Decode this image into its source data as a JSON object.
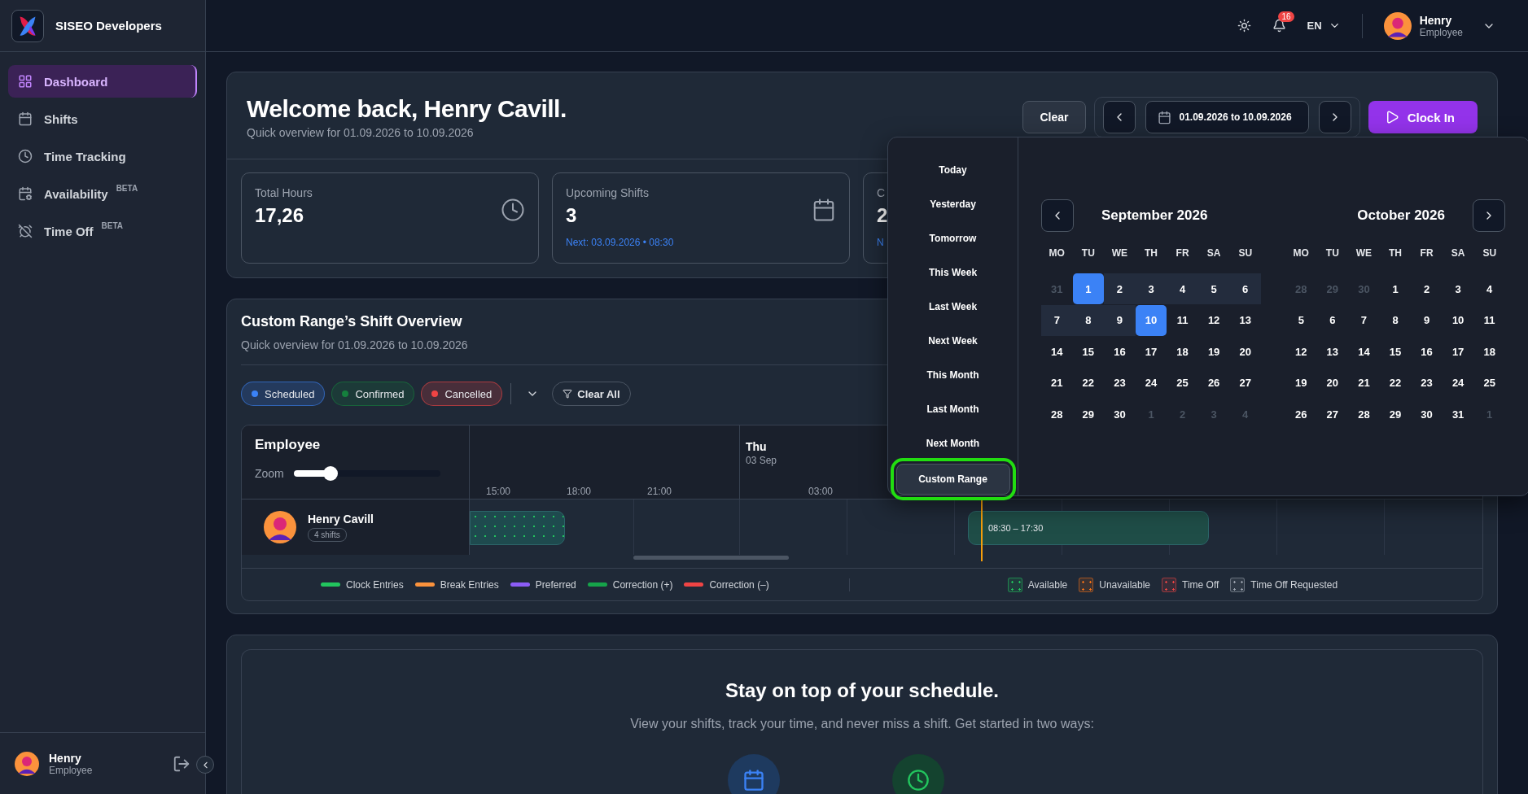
{
  "sidebar": {
    "brand": "SISEO Developers",
    "items": [
      {
        "label": "Dashboard",
        "selected": true
      },
      {
        "label": "Shifts",
        "selected": false
      },
      {
        "label": "Time Tracking",
        "selected": false
      },
      {
        "label": "Availability",
        "badge": "BETA",
        "selected": false
      },
      {
        "label": "Time Off",
        "badge": "BETA",
        "selected": false
      }
    ],
    "user": {
      "name": "Henry",
      "role": "Employee"
    }
  },
  "header": {
    "notifications": "16",
    "language": "EN",
    "user": {
      "name": "Henry",
      "role": "Employee"
    }
  },
  "welcome": {
    "title": "Welcome back, Henry Cavill.",
    "subtitle": "Quick overview for 01.09.2026 to 10.09.2026",
    "clear": "Clear",
    "range": "01.09.2026 to 10.09.2026",
    "clock_in": "Clock In",
    "stats": [
      {
        "label": "Total Hours",
        "value": "17,26"
      },
      {
        "label": "Upcoming Shifts",
        "value": "3",
        "note": "Next: 03.09.2026 • 08:30"
      },
      {
        "label": "C",
        "value": "2",
        "note": "N"
      }
    ]
  },
  "overview": {
    "title": "Custom Range’s Shift Overview",
    "subtitle": "Quick overview for 01.09.2026 to 10.09.2026",
    "filters": [
      {
        "label": "Scheduled",
        "color": "#3b82f6"
      },
      {
        "label": "Confirmed",
        "color": "#15803d"
      },
      {
        "label": "Cancelled",
        "color": "#ef4444"
      }
    ],
    "clear_all": "Clear All",
    "timeline": {
      "employee_header": "Employee",
      "zoom_label": "Zoom",
      "zoom": {
        "level": 0.25
      },
      "day": {
        "name": "Thu",
        "date": "03 Sep"
      },
      "hours": [
        "15:00",
        "18:00",
        "21:00",
        "03:00"
      ],
      "employee": {
        "name": "Henry Cavill",
        "badge": "4 shifts"
      },
      "shift_label": "08:30 – 17:30"
    },
    "legend": [
      {
        "label": "Clock Entries",
        "kind": "line",
        "color": "#22c55e"
      },
      {
        "label": "Break Entries",
        "kind": "line",
        "color": "#fb923c"
      },
      {
        "label": "Preferred",
        "kind": "line",
        "color": "#8b5cf6"
      },
      {
        "label": "Correction (+)",
        "kind": "line",
        "color": "#16a34a"
      },
      {
        "label": "Correction (–)",
        "kind": "line",
        "color": "#ef4444"
      },
      {
        "label": "Available",
        "kind": "box",
        "color": "#22c55e"
      },
      {
        "label": "Unavailable",
        "kind": "box",
        "color": "#f97316"
      },
      {
        "label": "Time Off",
        "kind": "box",
        "color": "#ef4444"
      },
      {
        "label": "Time Off Requested",
        "kind": "box",
        "color": "#9ca3af"
      }
    ]
  },
  "getting_started": {
    "title": "Stay on top of your schedule.",
    "text": "View your shifts, track your time, and never miss a shift. Get started in two ways:"
  },
  "date_picker": {
    "presets": [
      {
        "label": "Today",
        "selected": false
      },
      {
        "label": "Yesterday",
        "selected": false
      },
      {
        "label": "Tomorrow",
        "selected": false
      },
      {
        "label": "This Week",
        "selected": false
      },
      {
        "label": "Last Week",
        "selected": false
      },
      {
        "label": "Next Week",
        "selected": false
      },
      {
        "label": "This Month",
        "selected": false
      },
      {
        "label": "Last Month",
        "selected": false
      },
      {
        "label": "Next Month",
        "selected": false
      },
      {
        "label": "Custom Range",
        "selected": true
      }
    ],
    "months": [
      {
        "title": "September 2026",
        "weekdays": [
          "MO",
          "TU",
          "WE",
          "TH",
          "FR",
          "SA",
          "SU"
        ],
        "days": [
          {
            "label": "31",
            "outside": true,
            "in_range": false,
            "selected": false
          },
          {
            "label": "1",
            "outside": false,
            "in_range": true,
            "selected": true
          },
          {
            "label": "2",
            "outside": false,
            "in_range": true,
            "selected": false
          },
          {
            "label": "3",
            "outside": false,
            "in_range": true,
            "selected": false
          },
          {
            "label": "4",
            "outside": false,
            "in_range": true,
            "selected": false
          },
          {
            "label": "5",
            "outside": false,
            "in_range": true,
            "selected": false
          },
          {
            "label": "6",
            "outside": false,
            "in_range": true,
            "selected": false
          },
          {
            "label": "7",
            "outside": false,
            "in_range": true,
            "selected": false
          },
          {
            "label": "8",
            "outside": false,
            "in_range": true,
            "selected": false
          },
          {
            "label": "9",
            "outside": false,
            "in_range": true,
            "selected": false
          },
          {
            "label": "10",
            "outside": false,
            "in_range": true,
            "selected": true
          },
          {
            "label": "11",
            "outside": false,
            "in_range": false,
            "selected": false
          },
          {
            "label": "12",
            "outside": false,
            "in_range": false,
            "selected": false
          },
          {
            "label": "13",
            "outside": false,
            "in_range": false,
            "selected": false
          },
          {
            "label": "14",
            "outside": false,
            "in_range": false,
            "selected": false
          },
          {
            "label": "15",
            "outside": false,
            "in_range": false,
            "selected": false
          },
          {
            "label": "16",
            "outside": false,
            "in_range": false,
            "selected": false
          },
          {
            "label": "17",
            "outside": false,
            "in_range": false,
            "selected": false
          },
          {
            "label": "18",
            "outside": false,
            "in_range": false,
            "selected": false
          },
          {
            "label": "19",
            "outside": false,
            "in_range": false,
            "selected": false
          },
          {
            "label": "20",
            "outside": false,
            "in_range": false,
            "selected": false
          },
          {
            "label": "21",
            "outside": false,
            "in_range": false,
            "selected": false
          },
          {
            "label": "22",
            "outside": false,
            "in_range": false,
            "selected": false
          },
          {
            "label": "23",
            "outside": false,
            "in_range": false,
            "selected": false
          },
          {
            "label": "24",
            "outside": false,
            "in_range": false,
            "selected": false
          },
          {
            "label": "25",
            "outside": false,
            "in_range": false,
            "selected": false
          },
          {
            "label": "26",
            "outside": false,
            "in_range": false,
            "selected": false
          },
          {
            "label": "27",
            "outside": false,
            "in_range": false,
            "selected": false
          },
          {
            "label": "28",
            "outside": false,
            "in_range": false,
            "selected": false
          },
          {
            "label": "29",
            "outside": false,
            "in_range": false,
            "selected": false
          },
          {
            "label": "30",
            "outside": false,
            "in_range": false,
            "selected": false
          },
          {
            "label": "1",
            "outside": true,
            "in_range": false,
            "selected": false
          },
          {
            "label": "2",
            "outside": true,
            "in_range": false,
            "selected": false
          },
          {
            "label": "3",
            "outside": true,
            "in_range": false,
            "selected": false
          },
          {
            "label": "4",
            "outside": true,
            "in_range": false,
            "selected": false
          }
        ]
      },
      {
        "title": "October 2026",
        "weekdays": [
          "MO",
          "TU",
          "WE",
          "TH",
          "FR",
          "SA",
          "SU"
        ],
        "days": [
          {
            "label": "28",
            "outside": true,
            "in_range": false,
            "selected": false
          },
          {
            "label": "29",
            "outside": true,
            "in_range": false,
            "selected": false
          },
          {
            "label": "30",
            "outside": true,
            "in_range": false,
            "selected": false
          },
          {
            "label": "1",
            "outside": false,
            "in_range": false,
            "selected": false
          },
          {
            "label": "2",
            "outside": false,
            "in_range": false,
            "selected": false
          },
          {
            "label": "3",
            "outside": false,
            "in_range": false,
            "selected": false
          },
          {
            "label": "4",
            "outside": false,
            "in_range": false,
            "selected": false
          },
          {
            "label": "5",
            "outside": false,
            "in_range": false,
            "selected": false
          },
          {
            "label": "6",
            "outside": false,
            "in_range": false,
            "selected": false
          },
          {
            "label": "7",
            "outside": false,
            "in_range": false,
            "selected": false
          },
          {
            "label": "8",
            "outside": false,
            "in_range": false,
            "selected": false
          },
          {
            "label": "9",
            "outside": false,
            "in_range": false,
            "selected": false
          },
          {
            "label": "10",
            "outside": false,
            "in_range": false,
            "selected": false
          },
          {
            "label": "11",
            "outside": false,
            "in_range": false,
            "selected": false
          },
          {
            "label": "12",
            "outside": false,
            "in_range": false,
            "selected": false
          },
          {
            "label": "13",
            "outside": false,
            "in_range": false,
            "selected": false
          },
          {
            "label": "14",
            "outside": false,
            "in_range": false,
            "selected": false
          },
          {
            "label": "15",
            "outside": false,
            "in_range": false,
            "selected": false
          },
          {
            "label": "16",
            "outside": false,
            "in_range": false,
            "selected": false
          },
          {
            "label": "17",
            "outside": false,
            "in_range": false,
            "selected": false
          },
          {
            "label": "18",
            "outside": false,
            "in_range": false,
            "selected": false
          },
          {
            "label": "19",
            "outside": false,
            "in_range": false,
            "selected": false
          },
          {
            "label": "20",
            "outside": false,
            "in_range": false,
            "selected": false
          },
          {
            "label": "21",
            "outside": false,
            "in_range": false,
            "selected": false
          },
          {
            "label": "22",
            "outside": false,
            "in_range": false,
            "selected": false
          },
          {
            "label": "23",
            "outside": false,
            "in_range": false,
            "selected": false
          },
          {
            "label": "24",
            "outside": false,
            "in_range": false,
            "selected": false
          },
          {
            "label": "25",
            "outside": false,
            "in_range": false,
            "selected": false
          },
          {
            "label": "26",
            "outside": false,
            "in_range": false,
            "selected": false
          },
          {
            "label": "27",
            "outside": false,
            "in_range": false,
            "selected": false
          },
          {
            "label": "28",
            "outside": false,
            "in_range": false,
            "selected": false
          },
          {
            "label": "29",
            "outside": false,
            "in_range": false,
            "selected": false
          },
          {
            "label": "30",
            "outside": false,
            "in_range": false,
            "selected": false
          },
          {
            "label": "31",
            "outside": false,
            "in_range": false,
            "selected": false
          },
          {
            "label": "1",
            "outside": true,
            "in_range": false,
            "selected": false
          }
        ]
      }
    ]
  }
}
